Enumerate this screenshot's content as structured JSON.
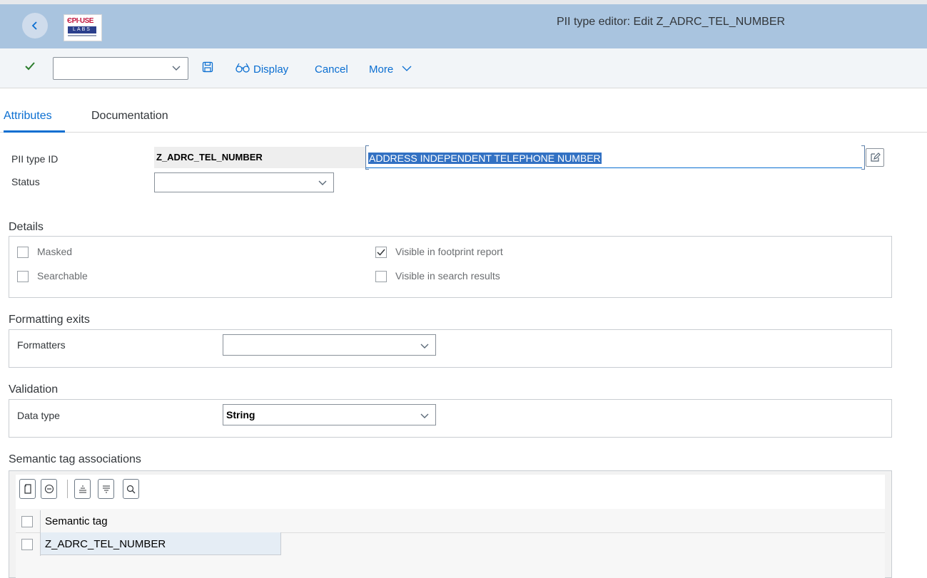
{
  "shell": {
    "title": "PII type editor: Edit Z_ADRC_TEL_NUMBER",
    "logo_text": "EPI-USE LABS"
  },
  "toolbar": {
    "command_value": "",
    "display_label": "Display",
    "cancel_label": "Cancel",
    "more_label": "More"
  },
  "tabs": [
    {
      "label": "Attributes",
      "active": true
    },
    {
      "label": "Documentation",
      "active": false
    }
  ],
  "header_fields": {
    "pii_type_id_label": "PII type ID",
    "pii_type_id_value": "Z_ADRC_TEL_NUMBER",
    "description_value": "ADDRESS INDEPENDENT TELEPHONE NUMBER",
    "status_label": "Status",
    "status_value": ""
  },
  "details": {
    "title": "Details",
    "options": [
      {
        "label": "Masked",
        "checked": false
      },
      {
        "label": "Searchable",
        "checked": false
      },
      {
        "label": "Visible in footprint report",
        "checked": true
      },
      {
        "label": "Visible in search results",
        "checked": false
      }
    ]
  },
  "formatting": {
    "title": "Formatting exits",
    "formatters_label": "Formatters",
    "formatters_value": ""
  },
  "validation": {
    "title": "Validation",
    "data_type_label": "Data type",
    "data_type_value": "String"
  },
  "semantic": {
    "title": "Semantic tag associations",
    "column_header": "Semantic tag",
    "rows": [
      "Z_ADRC_TEL_NUMBER"
    ]
  },
  "colors": {
    "shell_bg": "#a9c4df",
    "accent": "#0a6ed1",
    "check_green": "#2b7c2b",
    "selection": "#3271c3"
  }
}
